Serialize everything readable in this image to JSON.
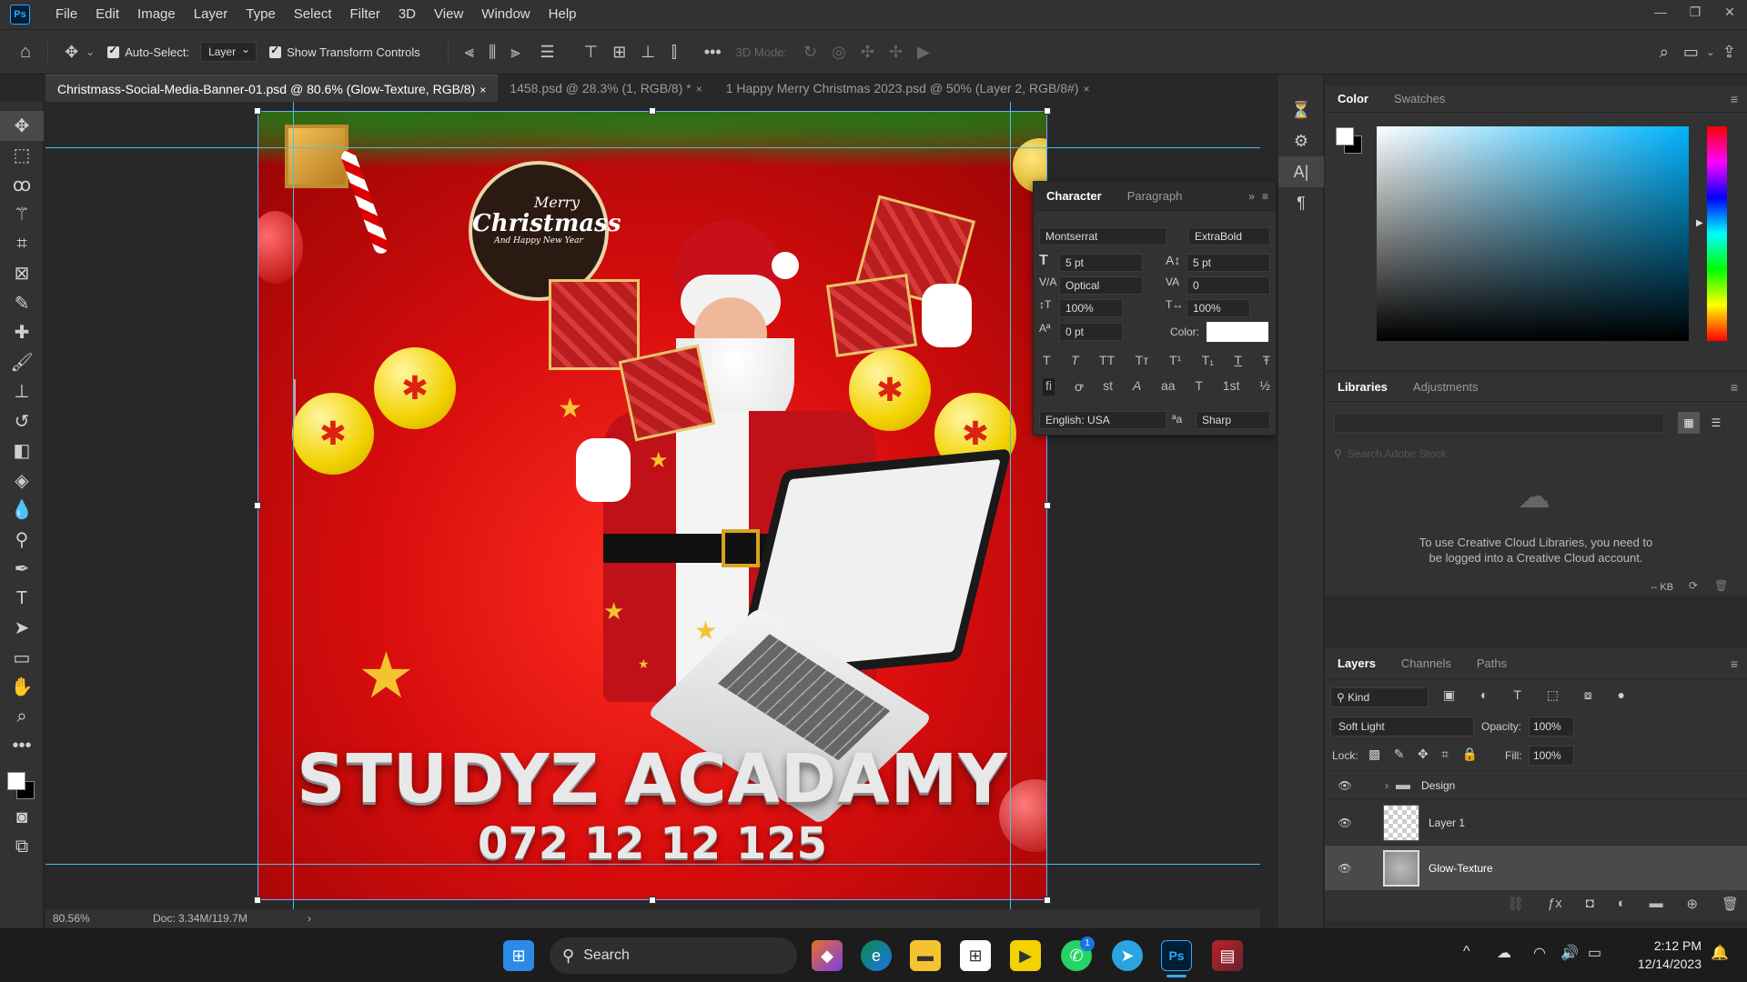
{
  "app": {
    "logo": "Ps"
  },
  "menu": [
    "File",
    "Edit",
    "Image",
    "Layer",
    "Type",
    "Select",
    "Filter",
    "3D",
    "View",
    "Window",
    "Help"
  ],
  "options": {
    "auto_select_label": "Auto-Select:",
    "auto_select_value": "Layer",
    "show_transform_label": "Show Transform Controls",
    "mode_3d_label": "3D Mode:"
  },
  "tabs": [
    {
      "label": "Christmass-Social-Media-Banner-01.psd @ 80.6% (Glow-Texture, RGB/8)",
      "close": "×"
    },
    {
      "label": "1458.psd @ 28.3% (1, RGB/8) *",
      "close": "×"
    },
    {
      "label": "1 Happy Merry Christmas 2023.psd @ 50% (Layer 2, RGB/8#)",
      "close": "×"
    }
  ],
  "status": {
    "zoom": "80.56%",
    "doc": "Doc: 3.34M/119.7M",
    "arrow": "›"
  },
  "artwork": {
    "badge_line1": "Merry",
    "badge_line2": "Christmass",
    "badge_line3": "And Happy New Year",
    "headline": "STUDYZ ACADAMY",
    "phone": "072 12 12 125"
  },
  "character": {
    "tabs": [
      "Character",
      "Paragraph"
    ],
    "font_family": "Montserrat",
    "font_style": "ExtraBold",
    "size": "5 pt",
    "leading": "5 pt",
    "kerning": "Optical",
    "tracking": "0",
    "vscale": "100%",
    "hscale": "100%",
    "baseline": "0 pt",
    "color_label": "Color:",
    "language": "English: USA",
    "antialias": "Sharp",
    "style_buttons": [
      "T",
      "T",
      "TT",
      "Tт",
      "T¹",
      "T₁",
      "T",
      "Ŧ"
    ],
    "ot_buttons": [
      "ﬁ",
      "ꝍ",
      "st",
      "A",
      "aa",
      "T",
      "1st",
      "½"
    ]
  },
  "color_panel": {
    "tabs": [
      "Color",
      "Swatches"
    ]
  },
  "libraries": {
    "tabs": [
      "Libraries",
      "Adjustments"
    ],
    "search_placeholder": "Search Adobe Stock",
    "message": "To use Creative Cloud Libraries, you need to be logged into a Creative Cloud account.",
    "kb": "-- KB"
  },
  "layers": {
    "tabs": [
      "Layers",
      "Channels",
      "Paths"
    ],
    "kind": "Kind",
    "blend": "Soft Light",
    "opacity_label": "Opacity:",
    "opacity": "100%",
    "lock_label": "Lock:",
    "fill_label": "Fill:",
    "fill": "100%",
    "items": [
      {
        "name": "Design",
        "type": "group"
      },
      {
        "name": "Layer 1",
        "type": "pixel"
      },
      {
        "name": "Glow-Texture",
        "type": "pixel",
        "selected": true
      }
    ]
  },
  "taskbar": {
    "search": "Search",
    "time": "2:12 PM",
    "date": "12/14/2023",
    "whatsapp_badge": "1"
  }
}
